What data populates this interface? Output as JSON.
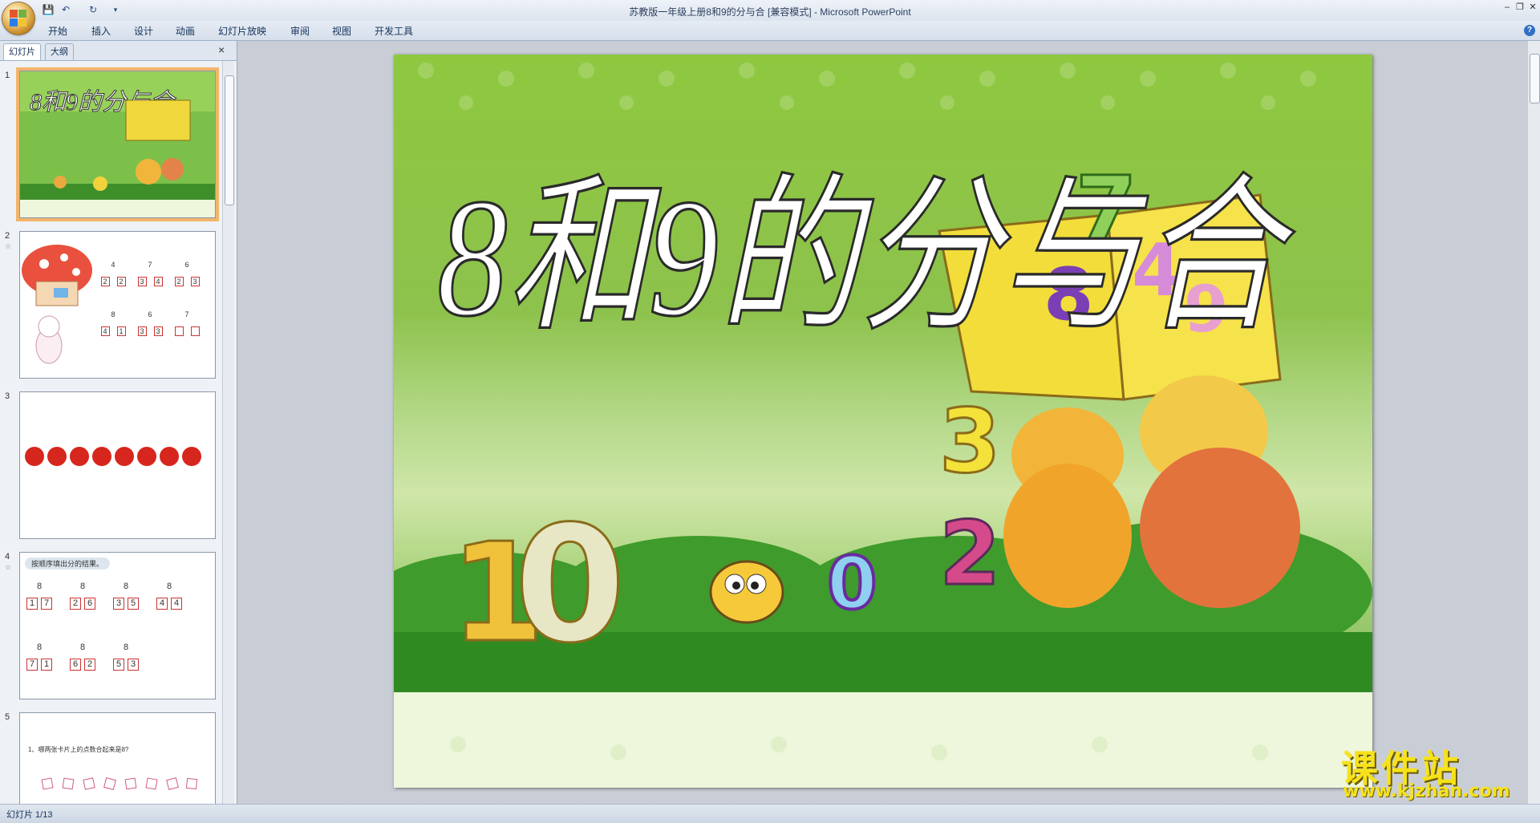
{
  "window": {
    "title": "苏教版一年级上册8和9的分与合 [兼容模式] - Microsoft PowerPoint"
  },
  "quick_access": {
    "save_icon": "save-icon",
    "undo_icon": "undo-icon",
    "redo_icon": "redo-icon",
    "customize_icon": "chevron-down-icon"
  },
  "ribbon_tabs": [
    "开始",
    "插入",
    "设计",
    "动画",
    "幻灯片放映",
    "审阅",
    "视图",
    "开发工具"
  ],
  "pane": {
    "tab_slides": "幻灯片",
    "tab_outline": "大纲",
    "close": "×"
  },
  "thumbnails": [
    {
      "number": "1",
      "title": "8和9的分与合"
    },
    {
      "number": "2"
    },
    {
      "number": "3"
    },
    {
      "number": "4",
      "heading": "按顺序填出分的结果。"
    },
    {
      "number": "5",
      "text": "1、哪两张卡片上的点数合起来是8?"
    }
  ],
  "thumb2": {
    "trees": [
      [
        "4",
        "2",
        "2"
      ],
      [
        "7",
        "3",
        "4"
      ],
      [
        "6",
        "2",
        "3"
      ],
      [
        "8",
        "4",
        "1"
      ],
      [
        "6",
        "3",
        "3"
      ],
      [
        "7",
        "",
        ""
      ]
    ]
  },
  "thumb4": {
    "row1": [
      [
        "8",
        "1",
        "7"
      ],
      [
        "8",
        "2",
        "6"
      ],
      [
        "8",
        "3",
        "5"
      ],
      [
        "8",
        "4",
        "4"
      ]
    ],
    "row2": [
      [
        "8",
        "7",
        "1"
      ],
      [
        "8",
        "6",
        "2"
      ],
      [
        "8",
        "5",
        "3"
      ]
    ]
  },
  "slide": {
    "title": "8和9的分与合",
    "book_numbers": [
      "8",
      "4",
      "9"
    ],
    "characters": [
      "1",
      "0",
      "7",
      "3",
      "2",
      "0"
    ]
  },
  "status": {
    "slide_counter": "幻灯片 1/13"
  },
  "watermark": {
    "line1": "课件站",
    "line2": "www.kjzhan.com"
  },
  "colors": {
    "accent": "#f2b46a",
    "slide_green": "#6aa83a",
    "title_fill": "#ffffff",
    "watermark_yellow": "#f6e21a"
  }
}
